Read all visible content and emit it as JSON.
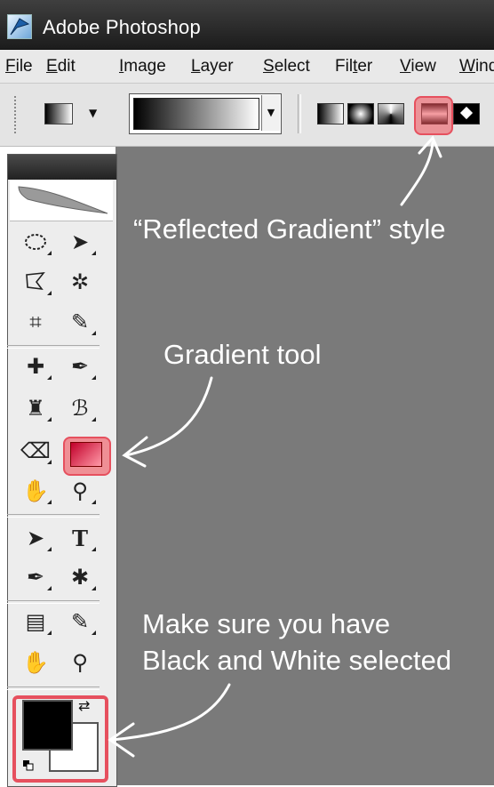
{
  "window": {
    "title": "Adobe Photoshop"
  },
  "menubar": [
    {
      "label": "File",
      "underline": "F",
      "rest": "ile"
    },
    {
      "label": "Edit",
      "underline": "E",
      "rest": "dit"
    },
    {
      "label": "Image",
      "underline": "I",
      "rest": "mage"
    },
    {
      "label": "Layer",
      "underline": "L",
      "rest": "ayer"
    },
    {
      "label": "Select",
      "underline": "S",
      "rest": "elect"
    },
    {
      "label": "Filter",
      "pre": "Fil",
      "underline": "t",
      "rest": "er"
    },
    {
      "label": "View",
      "underline": "V",
      "rest": "iew"
    },
    {
      "label": "Window",
      "underline": "W",
      "rest": "ind"
    }
  ],
  "options_bar": {
    "gradient_styles": [
      "Linear Gradient",
      "Radial Gradient",
      "Angle Gradient",
      "Reflected Gradient",
      "Diamond Gradient"
    ],
    "selected_style": "Reflected Gradient"
  },
  "annotations": {
    "reflected": "“Reflected Gradient” style",
    "gradient_tool": "Gradient tool",
    "colors_line1": "Make sure you have",
    "colors_line2": "Black and White selected"
  },
  "colors": {
    "foreground": "#000000",
    "background": "#ffffff",
    "highlight": "#e6505e",
    "canvas": "#7a7a7a"
  }
}
